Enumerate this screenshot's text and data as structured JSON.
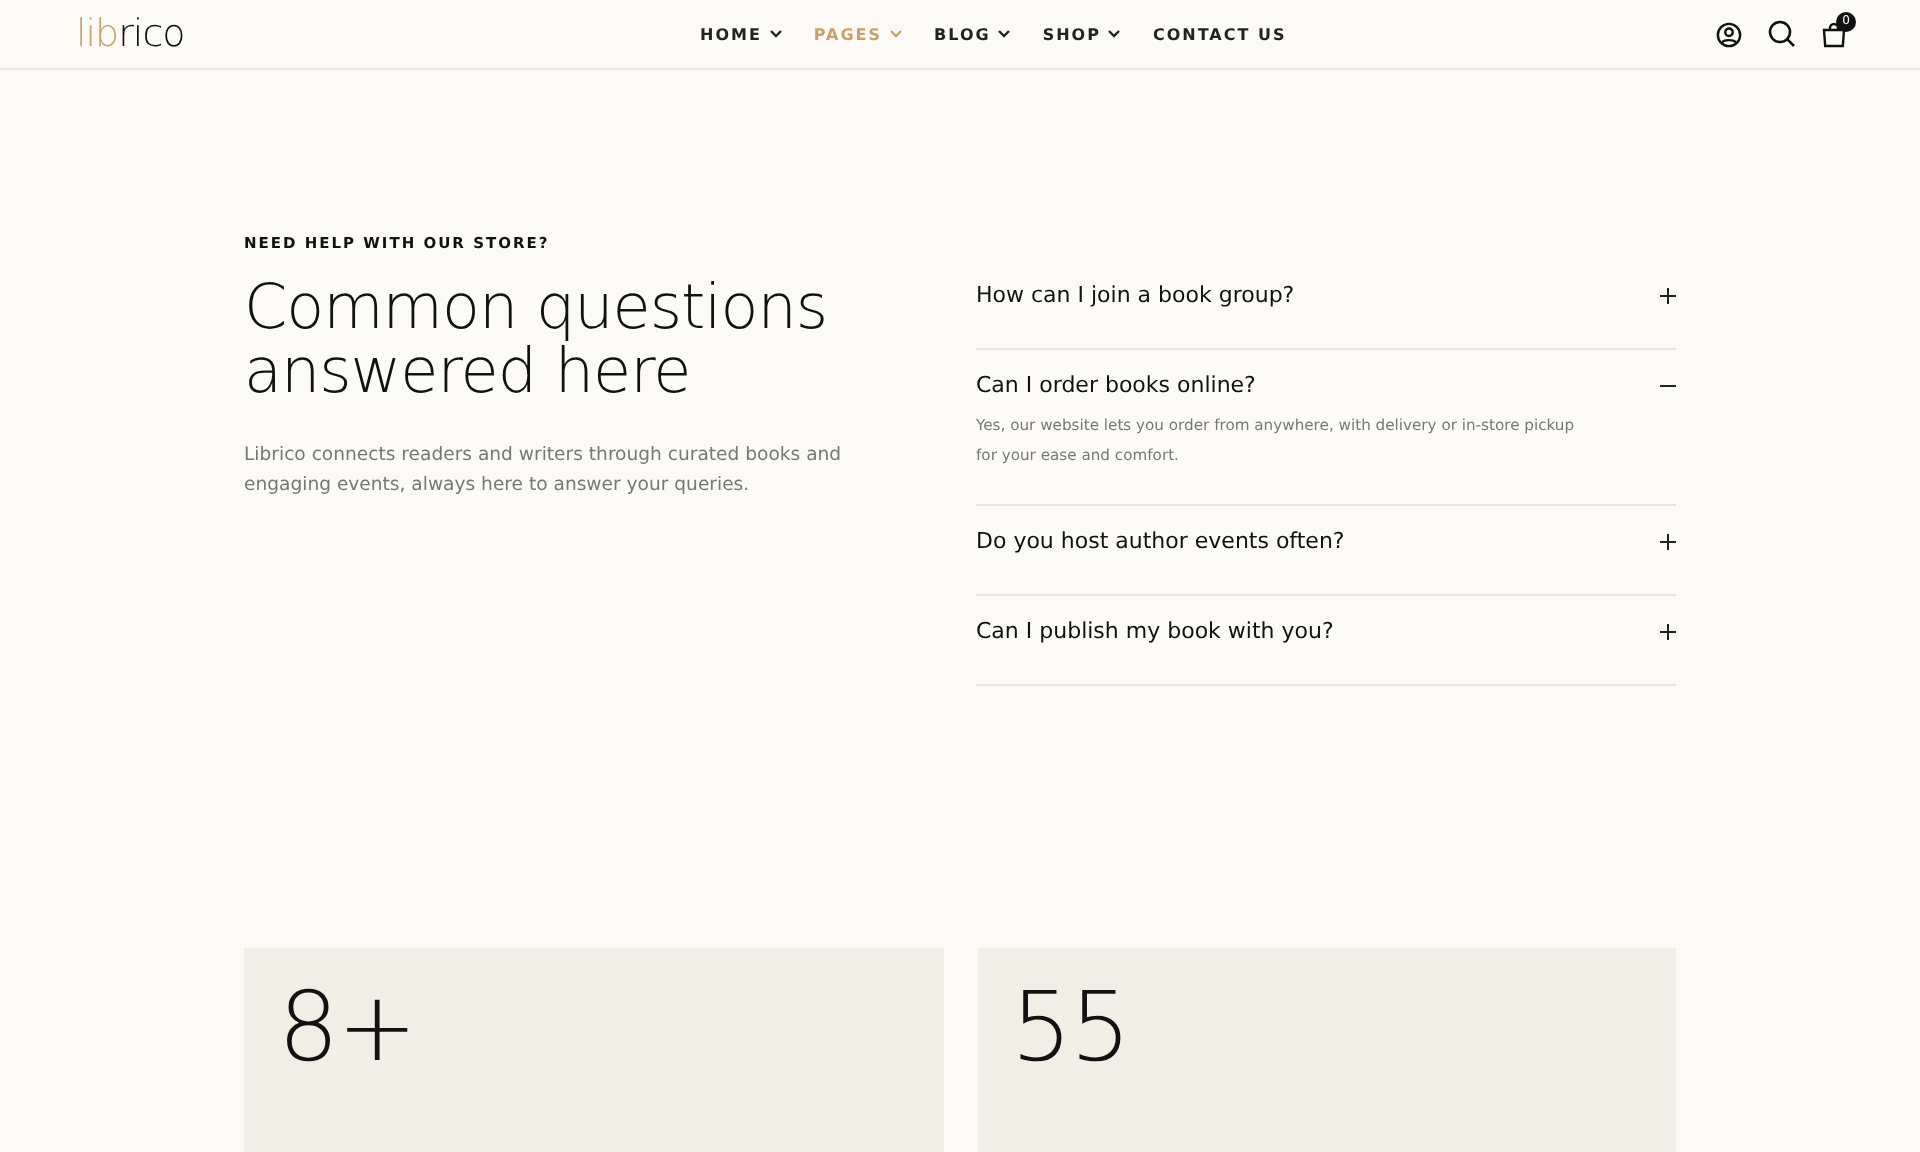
{
  "header": {
    "logo": {
      "accent": "lib",
      "rest": "rico"
    },
    "nav": [
      {
        "label": "HOME",
        "has_dropdown": true,
        "selected": false
      },
      {
        "label": "PAGES",
        "has_dropdown": true,
        "selected": true
      },
      {
        "label": "BLOG",
        "has_dropdown": true,
        "selected": false
      },
      {
        "label": "SHOP",
        "has_dropdown": true,
        "selected": false
      },
      {
        "label": "CONTACT US",
        "has_dropdown": false,
        "selected": false
      }
    ],
    "cart_count": "0"
  },
  "faq": {
    "eyebrow": "NEED HELP WITH OUR STORE?",
    "title": "Common questions answered here",
    "intro": "Librico connects readers and writers through curated books and engaging events, always here to answer your queries.",
    "items": [
      {
        "question": "How can I join a book group?",
        "expanded": false
      },
      {
        "question": "Can I order books online?",
        "expanded": true,
        "answer": "Yes, our website lets you order from anywhere, with delivery or in-store pickup for your ease and comfort."
      },
      {
        "question": "Do you host author events often?",
        "expanded": false
      },
      {
        "question": "Can I publish my book with you?",
        "expanded": false
      }
    ]
  },
  "stats": [
    {
      "value": "8+"
    },
    {
      "value": "55"
    }
  ]
}
